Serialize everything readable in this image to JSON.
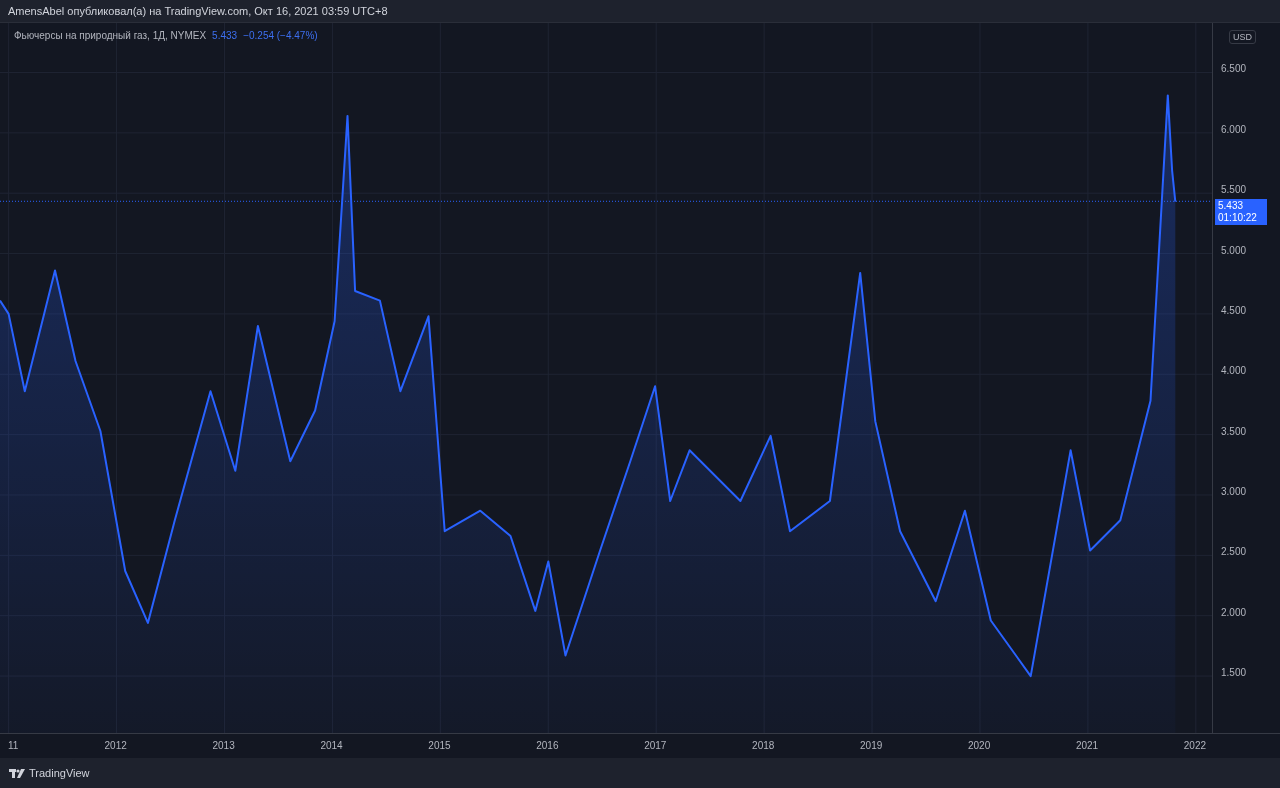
{
  "header": {
    "text": "AmensAbel опубликовал(а) на TradingView.com, Окт 16, 2021 03:59 UTC+8"
  },
  "legend": {
    "price": "5.433",
    "change": "−0.254 (−4.47%)"
  },
  "currency": "USD",
  "last_price": {
    "price": "5.433",
    "countdown": "01:10:22"
  },
  "chart_data": {
    "type": "area",
    "grid": true,
    "ref_lines": [
      {
        "axis": "y",
        "value": 5.433,
        "color": "#2962ff"
      }
    ],
    "xlim": [
      2010.92,
      2022.78
    ],
    "ylim": [
      1.02,
      6.91
    ],
    "xticks": [
      {
        "value": 2011,
        "label": "11"
      },
      {
        "value": 2012,
        "label": "2012"
      },
      {
        "value": 2013,
        "label": "2013"
      },
      {
        "value": 2014,
        "label": "2014"
      },
      {
        "value": 2015,
        "label": "2015"
      },
      {
        "value": 2016,
        "label": "2016"
      },
      {
        "value": 2017,
        "label": "2017"
      },
      {
        "value": 2018,
        "label": "2018"
      },
      {
        "value": 2019,
        "label": "2019"
      },
      {
        "value": 2020,
        "label": "2020"
      },
      {
        "value": 2021,
        "label": "2021"
      },
      {
        "value": 2022,
        "label": "2022"
      }
    ],
    "yticks": [
      {
        "value": 1.5,
        "label": "1.500"
      },
      {
        "value": 2,
        "label": "2.000"
      },
      {
        "value": 2.5,
        "label": "2.500"
      },
      {
        "value": 3,
        "label": "3.000"
      },
      {
        "value": 3.5,
        "label": "3.500"
      },
      {
        "value": 4,
        "label": "4.000"
      },
      {
        "value": 4.5,
        "label": "4.500"
      },
      {
        "value": 5,
        "label": "5.000"
      },
      {
        "value": 5.5,
        "label": "5.500"
      },
      {
        "value": 6,
        "label": "6.000"
      },
      {
        "value": 6.5,
        "label": "6.500"
      }
    ],
    "x": [
      2010.92,
      2011.0,
      2011.15,
      2011.43,
      2011.62,
      2011.85,
      2012.08,
      2012.29,
      2012.54,
      2012.87,
      2013.1,
      2013.31,
      2013.61,
      2013.84,
      2014.02,
      2014.14,
      2014.21,
      2014.44,
      2014.63,
      2014.89,
      2015.04,
      2015.37,
      2015.65,
      2015.88,
      2016.0,
      2016.16,
      2016.48,
      2016.76,
      2016.99,
      2017.13,
      2017.31,
      2017.78,
      2018.06,
      2018.24,
      2018.61,
      2018.89,
      2019.03,
      2019.26,
      2019.59,
      2019.86,
      2020.1,
      2020.47,
      2020.84,
      2021.02,
      2021.3,
      2021.58,
      2021.74,
      2021.78,
      2021.81
    ],
    "series": [
      {
        "name": "Фьючерсы на природный газ, 1Д, NYMEX",
        "color": "#2962ff",
        "values": [
          4.61,
          4.5,
          3.86,
          4.86,
          4.11,
          3.53,
          2.37,
          1.94,
          2.79,
          3.86,
          3.2,
          4.4,
          3.28,
          3.7,
          4.44,
          6.14,
          4.69,
          4.61,
          3.86,
          4.48,
          2.7,
          2.87,
          2.66,
          2.04,
          2.45,
          1.67,
          2.54,
          3.28,
          3.9,
          2.95,
          3.37,
          2.95,
          3.49,
          2.7,
          2.95,
          4.84,
          3.61,
          2.7,
          2.12,
          2.87,
          1.96,
          1.5,
          3.37,
          2.54,
          2.79,
          3.78,
          6.31,
          5.69,
          5.43
        ]
      }
    ]
  },
  "footer": {
    "logo": "TradingView"
  }
}
